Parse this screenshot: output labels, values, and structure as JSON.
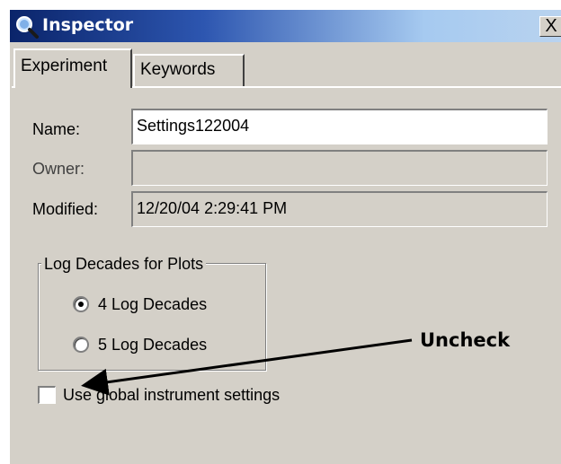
{
  "window": {
    "title": "Inspector",
    "close_label": "X"
  },
  "tabs": [
    {
      "label": "Experiment",
      "active": true
    },
    {
      "label": "Keywords",
      "active": false
    }
  ],
  "form": {
    "name_label": "Name:",
    "name_value": "Settings122004",
    "owner_label": "Owner:",
    "owner_value": "",
    "modified_label": "Modified:",
    "modified_value": "12/20/04 2:29:41 PM"
  },
  "log_group": {
    "legend": "Log Decades for Plots",
    "options": [
      {
        "label": "4 Log Decades",
        "selected": true
      },
      {
        "label": "5 Log Decades",
        "selected": false
      }
    ]
  },
  "global_settings": {
    "label": "Use global instrument settings",
    "checked": false
  },
  "annotation": {
    "text": "Uncheck"
  },
  "colors": {
    "title_bar_start": "#0a246a",
    "title_bar_end": "#a6caf0",
    "window_bg": "#d4d0c8"
  },
  "icons": {
    "title_icon": "magnifier-icon"
  }
}
